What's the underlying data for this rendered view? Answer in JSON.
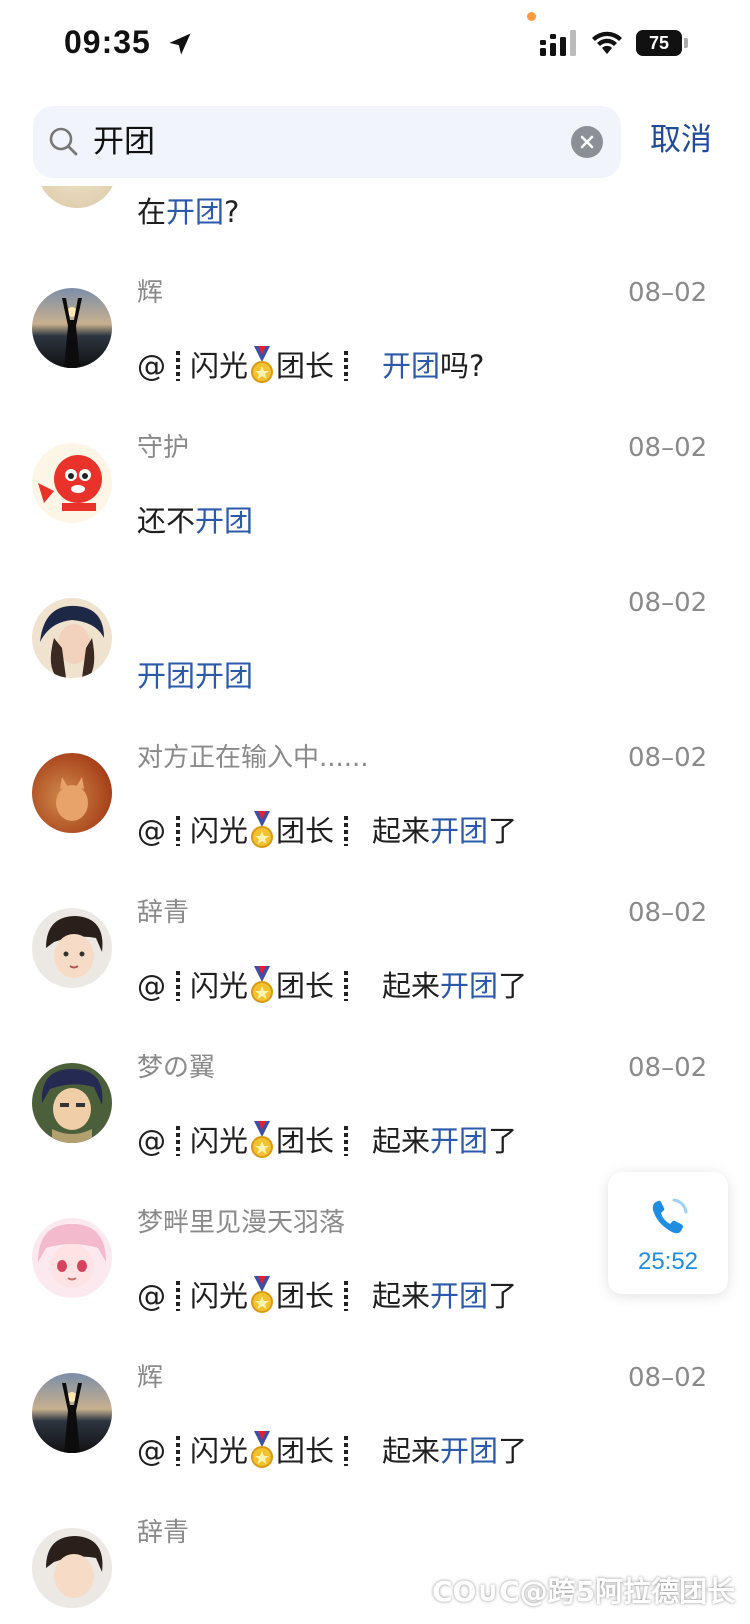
{
  "status_bar": {
    "time": "09:35",
    "battery": "75"
  },
  "search": {
    "query": "开团",
    "cancel_label": "取消"
  },
  "top_partial": {
    "text_before": "在",
    "keyword": "开团",
    "text_after": "?"
  },
  "messages": [
    {
      "name": "辉",
      "date": "08–02",
      "mention": {
        "at": "@",
        "user": "闪光",
        "title": "团长"
      },
      "before": "",
      "keyword": "开团",
      "after": "吗?"
    },
    {
      "name": "守护",
      "date": "08–02",
      "before": "还不",
      "keyword": "开团",
      "after": ""
    },
    {
      "name": "",
      "date": "08–02",
      "before": "",
      "keyword": "开团开团",
      "after": ""
    },
    {
      "name": "对方正在输入中......",
      "date": "08–02",
      "mention": {
        "at": "@",
        "user": "闪光",
        "title": "团长"
      },
      "before": "起来",
      "keyword": "开团",
      "after": "了"
    },
    {
      "name": "辞青",
      "date": "08–02",
      "mention": {
        "at": "@",
        "user": "闪光",
        "title": "团长"
      },
      "before": "起来",
      "keyword": "开团",
      "after": "了"
    },
    {
      "name": "梦の翼",
      "date": "08–02",
      "mention": {
        "at": "@",
        "user": "闪光",
        "title": "团长"
      },
      "before": "起来",
      "keyword": "开团",
      "after": "了"
    },
    {
      "name": "梦畔里见漫天羽落",
      "date": "",
      "mention": {
        "at": "@",
        "user": "闪光",
        "title": "团长"
      },
      "before": "起来",
      "keyword": "开团",
      "after": "了"
    },
    {
      "name": "辉",
      "date": "08–02",
      "mention": {
        "at": "@",
        "user": "闪光",
        "title": "团长"
      },
      "before": "起来",
      "keyword": "开团",
      "after": "了"
    },
    {
      "name": "辞青",
      "date": "",
      "before": "",
      "keyword": "",
      "after": ""
    }
  ],
  "call": {
    "duration": "25:52"
  },
  "watermark": "CO∪C@跨5阿拉德团长",
  "colors": {
    "accent": "#2b5aa8",
    "call": "#1f8de0",
    "muted": "#8a8a8a"
  }
}
